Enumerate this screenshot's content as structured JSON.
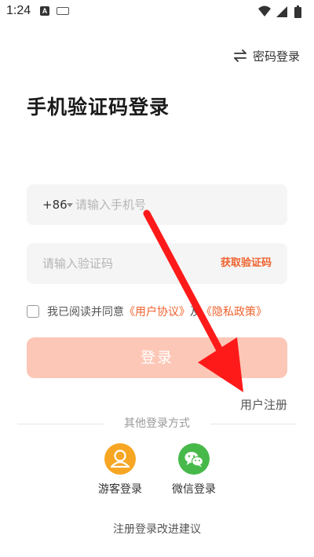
{
  "status_bar": {
    "time": "1:24",
    "notification_letter": "A"
  },
  "header": {
    "password_login_label": "密码登录"
  },
  "page_title": "手机验证码登录",
  "phone_field": {
    "country_code": "+86",
    "placeholder": "请输入手机号",
    "value": ""
  },
  "code_field": {
    "placeholder": "请输入验证码",
    "value": "",
    "get_code_label": "获取验证码"
  },
  "agreement": {
    "prefix": "我已阅读并同意",
    "user_agreement": "《用户协议》",
    "conjunction": "及",
    "privacy_policy": "《隐私政策》",
    "checked": false
  },
  "login_button_label": "登录",
  "register_label": "用户注册",
  "other_methods": {
    "title": "其他登录方式",
    "items": [
      {
        "label": "游客登录",
        "icon": "guest-user-icon"
      },
      {
        "label": "微信登录",
        "icon": "wechat-icon"
      }
    ]
  },
  "feedback_label": "注册登录改进建议",
  "colors": {
    "accent": "#f0622e",
    "login_button_bg": "#fcc7b6",
    "guest_icon_bg": "#f6a623",
    "wechat_icon_bg": "#47b94a",
    "annotation_arrow": "#ff1a1a"
  }
}
